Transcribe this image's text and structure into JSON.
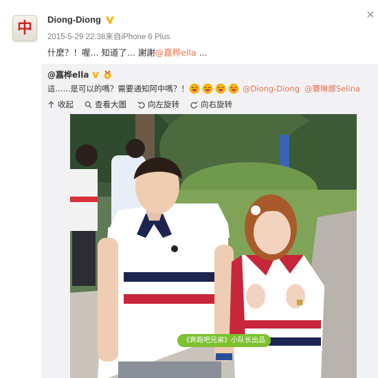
{
  "post": {
    "avatar_glyph": "中",
    "author": "Diong-Diong",
    "meta": "2015-5-29 22:38来自iPhone 6 Plus",
    "text": "什麼？！喔... 知道了... 謝謝",
    "mention": "@嘉桦ella",
    "ellipsis": " ..."
  },
  "repost": {
    "author": "@嘉桦ella",
    "text": "這......是可以的嗎？需要通知阿中嗎？！",
    "emoji_count": 4,
    "mention1": "@Diong-Diong",
    "mention2": "@賽琳娜Selina"
  },
  "actions": [
    {
      "label": "收起",
      "icon": "collapse-icon"
    },
    {
      "label": "查看大圖",
      "icon": "magnifier-icon"
    },
    {
      "label": "向左旋转",
      "icon": "rotate-left-icon"
    },
    {
      "label": "向右旋转",
      "icon": "rotate-right-icon"
    }
  ],
  "photo": {
    "watermark": "《奔跑吧兄弟》小队长出品"
  },
  "colors": {
    "mention": "#eb7350",
    "verified": "#f5b613",
    "repost_bg": "#f2f2f5",
    "watermark_bg": "#7dc12f"
  }
}
